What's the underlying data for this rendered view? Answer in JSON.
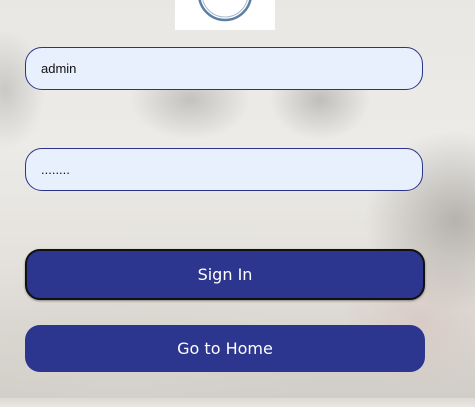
{
  "logo": {
    "icon": "circle-logo-icon"
  },
  "login_form": {
    "username_value": "admin",
    "password_value": "........"
  },
  "buttons": {
    "sign_in_label": "Sign In",
    "go_home_label": "Go to Home"
  },
  "colors": {
    "primary_button": "#2c368f",
    "field_background": "#e8effd",
    "field_border": "#2b348a"
  }
}
